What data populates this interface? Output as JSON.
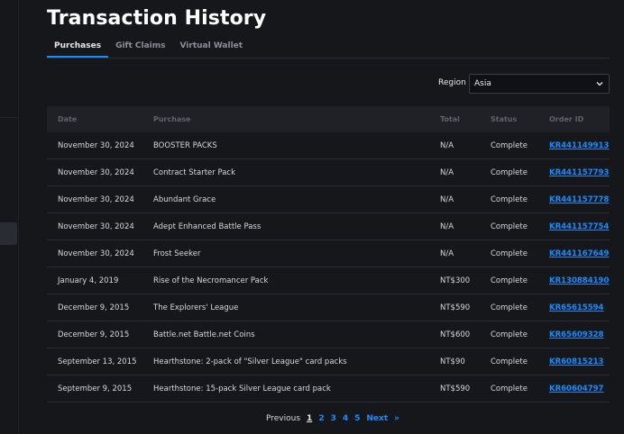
{
  "page": {
    "title": "Transaction History"
  },
  "tabs": [
    {
      "label": "Purchases",
      "active": true
    },
    {
      "label": "Gift Claims",
      "active": false
    },
    {
      "label": "Virtual Wallet",
      "active": false
    }
  ],
  "region": {
    "label": "Region",
    "value": "Asia"
  },
  "table": {
    "headers": {
      "date": "Date",
      "purchase": "Purchase",
      "total": "Total",
      "status": "Status",
      "order": "Order ID"
    },
    "rows": [
      {
        "date": "November 30, 2024",
        "purchase": "BOOSTER PACKS",
        "total": "N/A",
        "status": "Complete",
        "order": "KR441149913"
      },
      {
        "date": "November 30, 2024",
        "purchase": "Contract Starter Pack",
        "total": "N/A",
        "status": "Complete",
        "order": "KR441157793"
      },
      {
        "date": "November 30, 2024",
        "purchase": "Abundant Grace",
        "total": "N/A",
        "status": "Complete",
        "order": "KR441157778"
      },
      {
        "date": "November 30, 2024",
        "purchase": "Adept Enhanced Battle Pass",
        "total": "N/A",
        "status": "Complete",
        "order": "KR441157754"
      },
      {
        "date": "November 30, 2024",
        "purchase": "Frost Seeker",
        "total": "N/A",
        "status": "Complete",
        "order": "KR441167649"
      },
      {
        "date": "January 4, 2019",
        "purchase": "Rise of the Necromancer Pack",
        "total": "NT$300",
        "status": "Complete",
        "order": "KR130884190"
      },
      {
        "date": "December 9, 2015",
        "purchase": "The Explorers' League",
        "total": "NT$590",
        "status": "Complete",
        "order": "KR65615594"
      },
      {
        "date": "December 9, 2015",
        "purchase": "Battle.net Battle.net Coins",
        "total": "NT$600",
        "status": "Complete",
        "order": "KR65609328"
      },
      {
        "date": "September 13, 2015",
        "purchase": "Hearthstone: 2-pack of \"Silver League\" card packs",
        "total": "NT$90",
        "status": "Complete",
        "order": "KR60815213"
      },
      {
        "date": "September 9, 2015",
        "purchase": "Hearthstone: 15-pack Silver League card pack",
        "total": "NT$590",
        "status": "Complete",
        "order": "KR60604797"
      }
    ]
  },
  "pagination": {
    "previous": "Previous",
    "pages": [
      "1",
      "2",
      "3",
      "4",
      "5"
    ],
    "current": "1",
    "next": "Next",
    "last": "»"
  },
  "colors": {
    "accent": "#148eff",
    "background": "#16171b",
    "header": "#1f2126"
  },
  "icons": {
    "region_dropdown": "chevron-down-icon"
  }
}
